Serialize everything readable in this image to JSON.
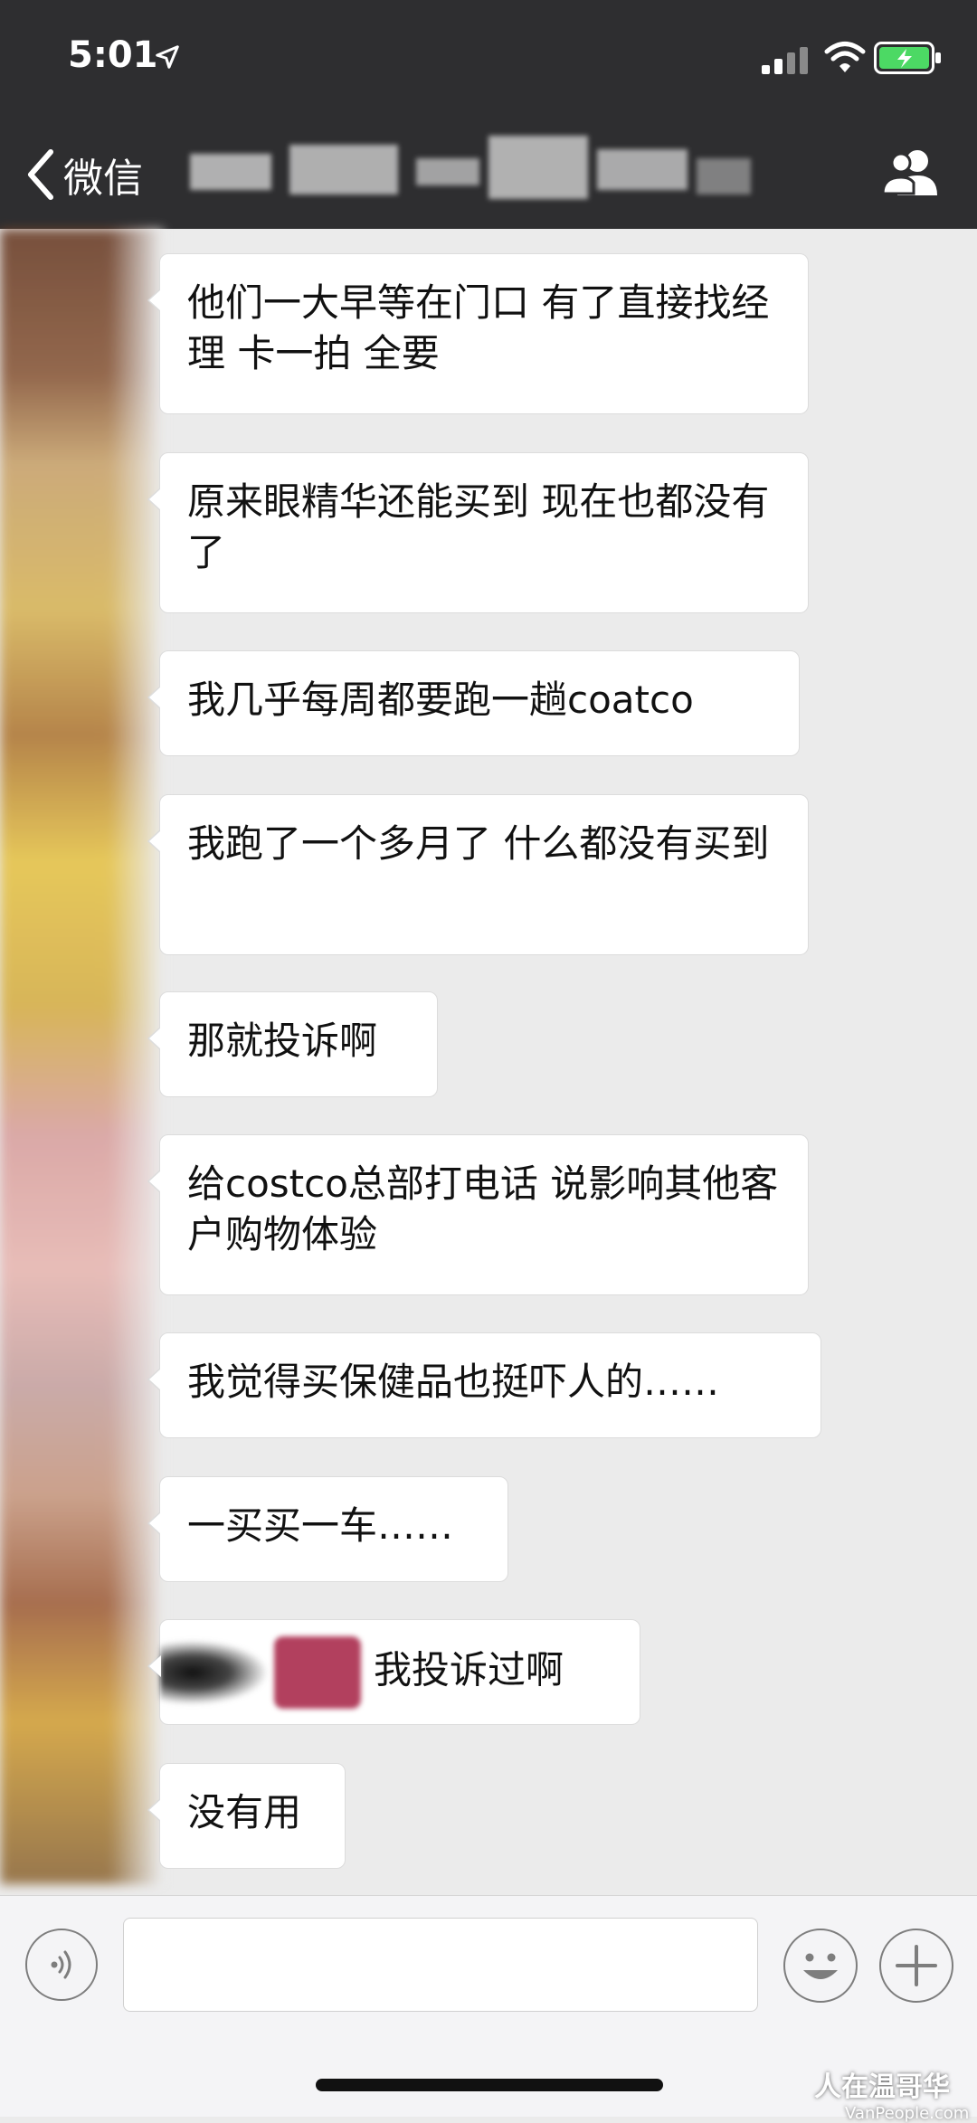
{
  "status_bar": {
    "time": "5:01"
  },
  "nav": {
    "back_label": "微信",
    "title": ""
  },
  "messages": [
    {
      "text": "他们一大早等在门口 有了直接找经理 卡一拍 全要"
    },
    {
      "text": "原来眼精华还能买到 现在也都没有了"
    },
    {
      "text": "我几乎每周都要跑一趟coatco"
    },
    {
      "text": "我跑了一个多月了 什么都没有买到"
    },
    {
      "text": "那就投诉啊"
    },
    {
      "text": "给costco总部打电话 说影响其他客户购物体验"
    },
    {
      "text": "我觉得买保健品也挺吓人的……"
    },
    {
      "text": "一买买一车……"
    },
    {
      "text": "我投诉过啊"
    },
    {
      "text": "没有用"
    }
  ],
  "input": {
    "placeholder": ""
  },
  "watermark": {
    "main": "人在温哥华",
    "sub": "VanPeople.com"
  },
  "colors": {
    "nav_bg": "#2e2e30",
    "chat_bg": "#ebebeb",
    "bubble_bg": "#ffffff",
    "battery_green": "#4cd964"
  },
  "icons": [
    "location-arrow-icon",
    "signal-icon",
    "wifi-icon",
    "battery-charging-icon",
    "back-chevron-icon",
    "members-icon",
    "voice-icon",
    "emoji-icon",
    "plus-icon"
  ]
}
